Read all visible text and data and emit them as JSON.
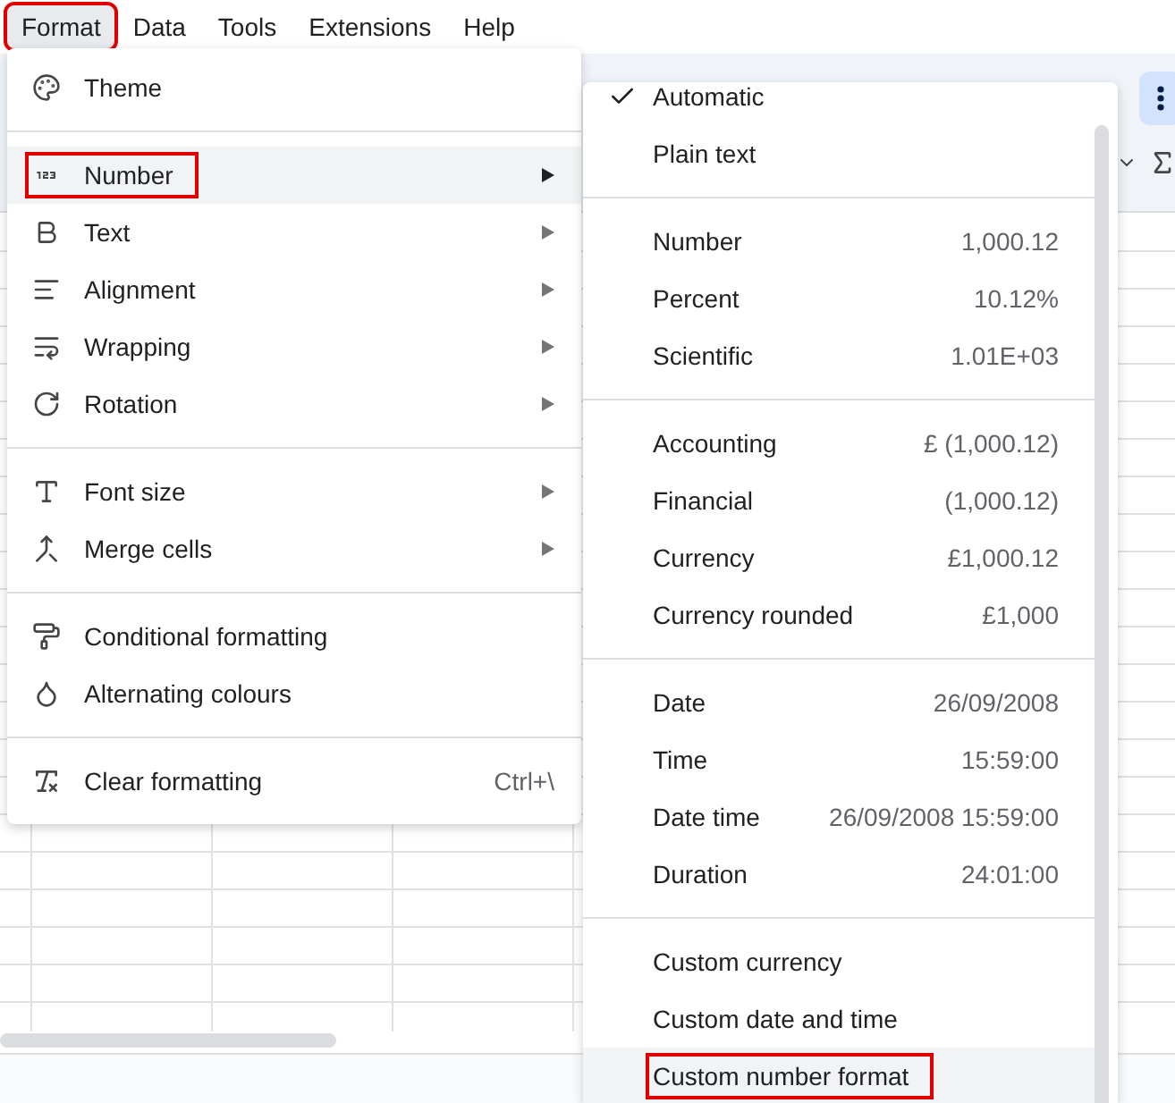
{
  "menubar": [
    {
      "label": "Format",
      "selected": true,
      "outlined": true
    },
    {
      "label": "Data",
      "selected": false,
      "outlined": false
    },
    {
      "label": "Tools",
      "selected": false,
      "outlined": false
    },
    {
      "label": "Extensions",
      "selected": false,
      "outlined": false
    },
    {
      "label": "Help",
      "selected": false,
      "outlined": false
    }
  ],
  "format_menu": [
    [
      {
        "label": "Theme",
        "submenu": false,
        "selected": false,
        "outlined": false
      }
    ],
    [
      {
        "label": "Number",
        "submenu": true,
        "selected": true,
        "outlined": true
      },
      {
        "label": "Text",
        "submenu": true,
        "selected": false,
        "outlined": false
      },
      {
        "label": "Alignment",
        "submenu": true,
        "selected": false,
        "outlined": false
      },
      {
        "label": "Wrapping",
        "submenu": true,
        "selected": false,
        "outlined": false
      },
      {
        "label": "Rotation",
        "submenu": true,
        "selected": false,
        "outlined": false
      }
    ],
    [
      {
        "label": "Font size",
        "submenu": true,
        "selected": false,
        "outlined": false
      },
      {
        "label": "Merge cells",
        "submenu": true,
        "selected": false,
        "outlined": false
      }
    ],
    [
      {
        "label": "Conditional formatting",
        "submenu": false,
        "selected": false,
        "outlined": false
      },
      {
        "label": "Alternating colours",
        "submenu": false,
        "selected": false,
        "outlined": false
      }
    ],
    [
      {
        "label": "Clear formatting",
        "submenu": false,
        "shortcut": "Ctrl+\\",
        "selected": false,
        "outlined": false
      }
    ]
  ],
  "number_submenu": [
    [
      {
        "label": "Automatic",
        "checked": true,
        "selected": false,
        "outlined": false
      },
      {
        "label": "Plain text",
        "checked": false,
        "selected": false,
        "outlined": false
      }
    ],
    [
      {
        "label": "Number",
        "value": "1,000.12",
        "checked": false,
        "selected": false,
        "outlined": false
      },
      {
        "label": "Percent",
        "value": "10.12%",
        "checked": false,
        "selected": false,
        "outlined": false
      },
      {
        "label": "Scientific",
        "value": "1.01E+03",
        "checked": false,
        "selected": false,
        "outlined": false
      }
    ],
    [
      {
        "label": "Accounting",
        "value": "£ (1,000.12)",
        "checked": false,
        "selected": false,
        "outlined": false
      },
      {
        "label": "Financial",
        "value": "(1,000.12)",
        "checked": false,
        "selected": false,
        "outlined": false
      },
      {
        "label": "Currency",
        "value": "£1,000.12",
        "checked": false,
        "selected": false,
        "outlined": false
      },
      {
        "label": "Currency rounded",
        "value": "£1,000",
        "checked": false,
        "selected": false,
        "outlined": false
      }
    ],
    [
      {
        "label": "Date",
        "value": "26/09/2008",
        "checked": false,
        "selected": false,
        "outlined": false
      },
      {
        "label": "Time",
        "value": "15:59:00",
        "checked": false,
        "selected": false,
        "outlined": false
      },
      {
        "label": "Date time",
        "value": "26/09/2008 15:59:00",
        "checked": false,
        "selected": false,
        "outlined": false
      },
      {
        "label": "Duration",
        "value": "24:01:00",
        "checked": false,
        "selected": false,
        "outlined": false
      }
    ],
    [
      {
        "label": "Custom currency",
        "checked": false,
        "selected": false,
        "outlined": false
      },
      {
        "label": "Custom date and time",
        "checked": false,
        "selected": false,
        "outlined": false
      },
      {
        "label": "Custom number format",
        "checked": false,
        "selected": true,
        "outlined": true
      }
    ]
  ]
}
